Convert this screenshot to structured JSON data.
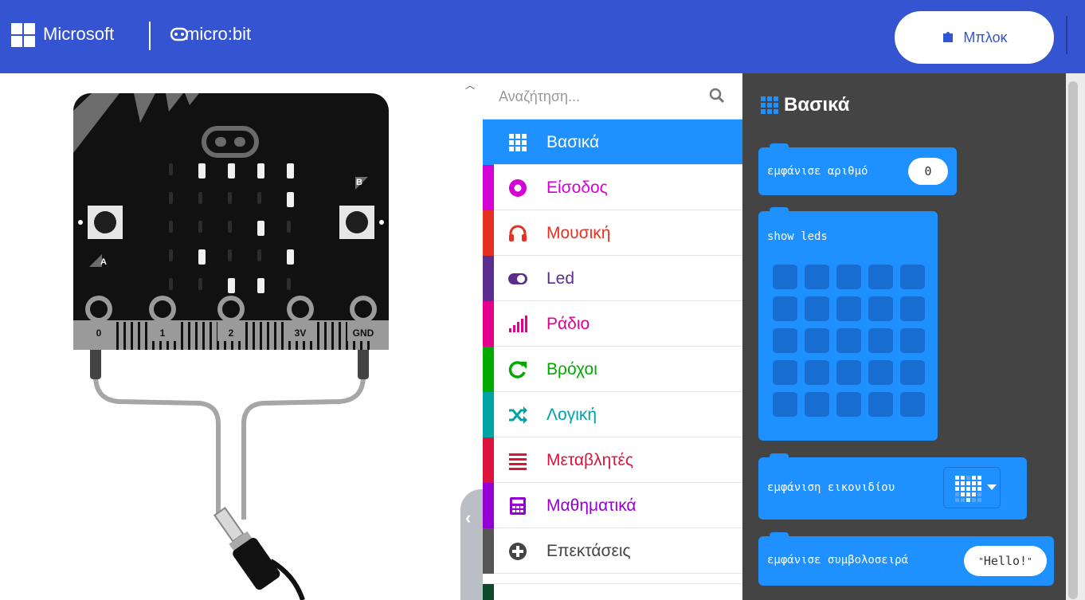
{
  "header": {
    "brand": "Microsoft",
    "product": "micro:bit",
    "blocks_button_label": "Μπλοκ"
  },
  "simulator": {
    "pin_labels": [
      "0",
      "1",
      "2",
      "3V",
      "GND"
    ],
    "button_a_label": "A",
    "button_b_label": "B",
    "lit_leds": [
      [
        0,
        1
      ],
      [
        0,
        2
      ],
      [
        0,
        3
      ],
      [
        0,
        4
      ],
      [
        1,
        4
      ],
      [
        2,
        3
      ],
      [
        3,
        1
      ],
      [
        3,
        4
      ],
      [
        4,
        2
      ],
      [
        4,
        3
      ]
    ]
  },
  "toolbox": {
    "search_placeholder": "Αναζήτηση...",
    "categories": [
      {
        "label": "Βασικά",
        "color": "#1e90ff",
        "icon": "grid-icon"
      },
      {
        "label": "Είσοδος",
        "color": "#d400d4",
        "icon": "circle-icon"
      },
      {
        "label": "Μουσική",
        "color": "#e63022",
        "icon": "headphones-icon"
      },
      {
        "label": "Led",
        "color": "#5c2d91",
        "icon": "toggle-icon"
      },
      {
        "label": "Ράδιο",
        "color": "#e3008c",
        "icon": "signal-icon"
      },
      {
        "label": "Βρόχοι",
        "color": "#00aa00",
        "icon": "refresh-icon"
      },
      {
        "label": "Λογική",
        "color": "#00a4a6",
        "icon": "shuffle-icon"
      },
      {
        "label": "Μεταβλητές",
        "color": "#dc143c",
        "icon": "list-icon"
      },
      {
        "label": "Μαθηματικά",
        "color": "#9400d3",
        "icon": "calculator-icon"
      },
      {
        "label": "Επεκτάσεις",
        "color": "#555555",
        "icon": "plus-circle-icon"
      }
    ]
  },
  "flyout": {
    "title": "Βασικά",
    "block_show_number": "εμφάνισε αριθμό",
    "block_show_number_value": "0",
    "block_show_leds": "show leds",
    "block_show_icon": "εμφάνιση εικονιδίου",
    "block_show_string": "εμφάνισε συμβολοσειρά",
    "block_show_string_value": "Hello!"
  }
}
